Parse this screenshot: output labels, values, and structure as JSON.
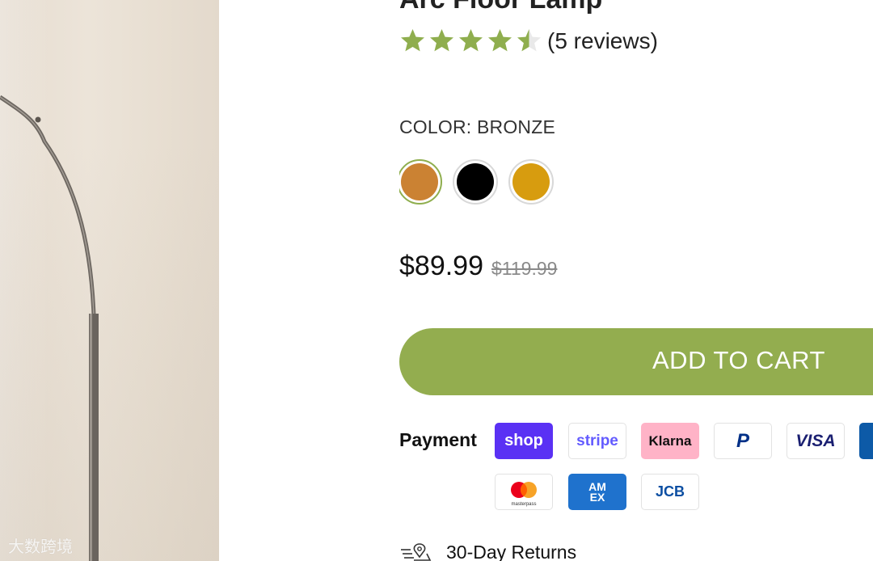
{
  "product": {
    "title": "Arc Floor Lamp",
    "rating_value": 4.5,
    "rating_max": 5,
    "reviews_text": "(5 reviews)",
    "color_label": "COLOR: BRONZE",
    "swatches": [
      {
        "name": "Bronze",
        "color": "#cb8233",
        "selected": true
      },
      {
        "name": "Black",
        "color": "#000000",
        "selected": false
      },
      {
        "name": "Gold",
        "color": "#d79c0f",
        "selected": false
      }
    ],
    "price_current": "$89.99",
    "price_original": "$119.99",
    "add_to_cart_label": "ADD TO CART"
  },
  "payment": {
    "label": "Payment",
    "methods": [
      {
        "name": "Shop Pay",
        "text": "shop",
        "bg": "#5a31f4",
        "fg": "#ffffff"
      },
      {
        "name": "Stripe",
        "text": "stripe",
        "bg": "#ffffff",
        "fg": "#635bff"
      },
      {
        "name": "Klarna",
        "text": "Klarna",
        "bg": "#ffb3c7",
        "fg": "#111111"
      },
      {
        "name": "PayPal",
        "text": "P",
        "bg": "#ffffff",
        "fg": "#003087"
      },
      {
        "name": "Visa",
        "text": "VISA",
        "bg": "#ffffff",
        "fg": "#1a1f71"
      },
      {
        "name": "Maestro",
        "text": "B",
        "bg": "#0d5aa7",
        "fg": "#ffffff"
      },
      {
        "name": "Masterpass",
        "text": "masterpass",
        "bg": "#ffffff",
        "fg": "#333333"
      },
      {
        "name": "American Express",
        "text": "AM EX",
        "bg": "#1f72cd",
        "fg": "#ffffff"
      },
      {
        "name": "JCB",
        "text": "JCB",
        "bg": "#ffffff",
        "fg": "#0b4ea2"
      }
    ]
  },
  "features": {
    "returns_label": "30-Day Returns"
  },
  "watermark": {
    "text": "大数跨境"
  },
  "colors": {
    "accent": "#93ad4f",
    "star": "#8fae4e"
  }
}
